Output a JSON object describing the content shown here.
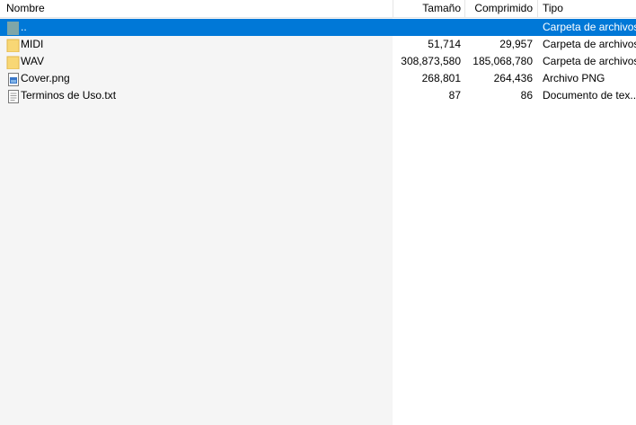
{
  "columns": {
    "name": "Nombre",
    "size": "Tamaño",
    "compressed": "Comprimido",
    "type": "Tipo"
  },
  "rows": [
    {
      "name": "..",
      "size": "",
      "compressed": "",
      "type": "Carpeta de archivos",
      "icon": "parent-folder-icon"
    },
    {
      "name": "MIDI",
      "size": "51,714",
      "compressed": "29,957",
      "type": "Carpeta de archivos",
      "icon": "folder-icon"
    },
    {
      "name": "WAV",
      "size": "308,873,580",
      "compressed": "185,068,780",
      "type": "Carpeta de archivos",
      "icon": "folder-icon"
    },
    {
      "name": "Cover.png",
      "size": "268,801",
      "compressed": "264,436",
      "type": "Archivo PNG",
      "icon": "image-file-icon"
    },
    {
      "name": "Terminos de Uso.txt",
      "size": "87",
      "compressed": "86",
      "type": "Documento de tex...",
      "icon": "text-file-icon"
    }
  ],
  "colors": {
    "selection": "#0078d7",
    "folder": "#f8d775",
    "name_column_bg": "#f5f5f5"
  }
}
